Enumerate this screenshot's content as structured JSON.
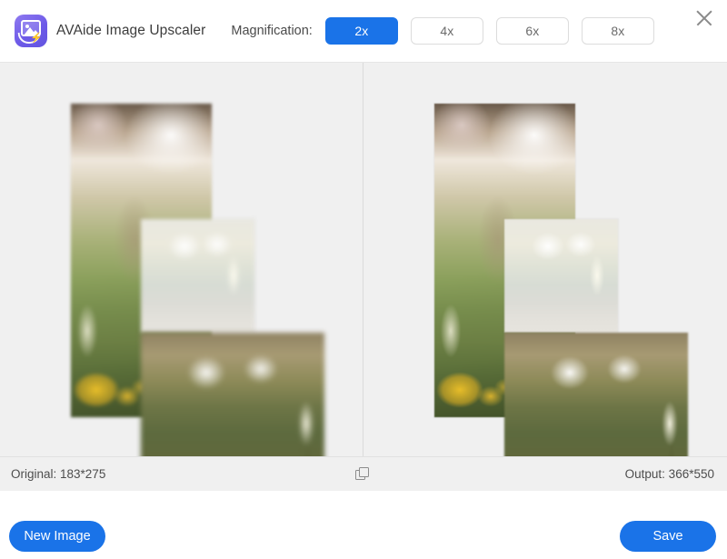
{
  "header": {
    "brand_title": "AVAide Image Upscaler",
    "logo_icon": "image-logo-icon",
    "magnification_label": "Magnification:",
    "magnification_options": [
      {
        "label": "2x",
        "selected": true
      },
      {
        "label": "4x",
        "selected": false
      },
      {
        "label": "6x",
        "selected": false
      },
      {
        "label": "8x",
        "selected": false
      }
    ],
    "close_icon": "close-icon"
  },
  "preview": {
    "left_pane_name": "original-preview",
    "right_pane_name": "upscaled-preview",
    "image_subject": "blurred meadow photo collage with grass seed heads and yellow buttercups"
  },
  "statusbar": {
    "original_label": "Original: 183*275",
    "output_label": "Output: 366*550",
    "compare_icon": "copy-duplicate-icon"
  },
  "footer": {
    "new_image_label": "New Image",
    "save_label": "Save"
  },
  "colors": {
    "accent_blue": "#1a73e8",
    "brand_purple": "#6d5ae8",
    "panel_gray": "#f0f0f0",
    "header_white": "#ffffff",
    "text_gray": "#4d4d4d"
  }
}
